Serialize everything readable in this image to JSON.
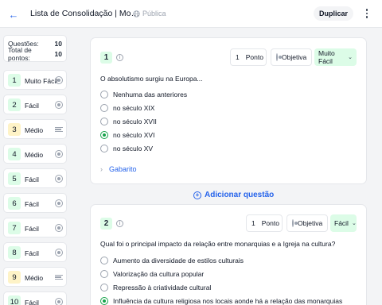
{
  "header": {
    "title": "Lista de Consolidação | Mo…",
    "visibility": "Pública",
    "duplicate_label": "Duplicar"
  },
  "summary": {
    "questions_label": "Questões:",
    "questions_value": "10",
    "points_label": "Total de pontos:",
    "points_value": "10"
  },
  "nav": [
    {
      "num": "1",
      "level": "Muito Fácil",
      "icon": "radio-icon"
    },
    {
      "num": "2",
      "level": "Fácil",
      "icon": "radio-icon"
    },
    {
      "num": "3",
      "level": "Médio",
      "icon": "text-lines-icon"
    },
    {
      "num": "4",
      "level": "Médio",
      "icon": "radio-icon"
    },
    {
      "num": "5",
      "level": "Fácil",
      "icon": "radio-icon"
    },
    {
      "num": "6",
      "level": "Fácil",
      "icon": "radio-icon"
    },
    {
      "num": "7",
      "level": "Fácil",
      "icon": "radio-icon"
    },
    {
      "num": "8",
      "level": "Fácil",
      "icon": "radio-icon"
    },
    {
      "num": "9",
      "level": "Médio",
      "icon": "text-lines-icon"
    },
    {
      "num": "10",
      "level": "Fácil",
      "icon": "radio-icon"
    }
  ],
  "questions": [
    {
      "num": "1",
      "points_value": "1",
      "points_label": "Ponto",
      "type": "Objetiva",
      "difficulty": "Muito Fácil",
      "text": "O absolutismo surgiu na Europa...",
      "options": [
        "Nenhuma das anteriores",
        "no século XIX",
        "no século XVII",
        "no século XVI",
        "no século XV"
      ],
      "selected": 3,
      "answer_key_label": "Gabarito"
    },
    {
      "num": "2",
      "points_value": "1",
      "points_label": "Ponto",
      "type": "Objetiva",
      "difficulty": "Fácil",
      "text": "Qual foi o principal impacto da relação entre monarquias e a Igreja na cultura?",
      "options": [
        "Aumento da diversidade de estilos culturais",
        "Valorização da cultura popular",
        "Repressão à criatividade cultural",
        "Influência da cultura religiosa nos locais aonde há a relação das monarquias"
      ],
      "selected": 3
    }
  ],
  "add_question_label": "Adicionar questão",
  "colors": {
    "accent": "#2563eb",
    "easy_badge": "#dcfce7",
    "medium_badge": "#fef3c7",
    "selected": "#16a34a"
  }
}
